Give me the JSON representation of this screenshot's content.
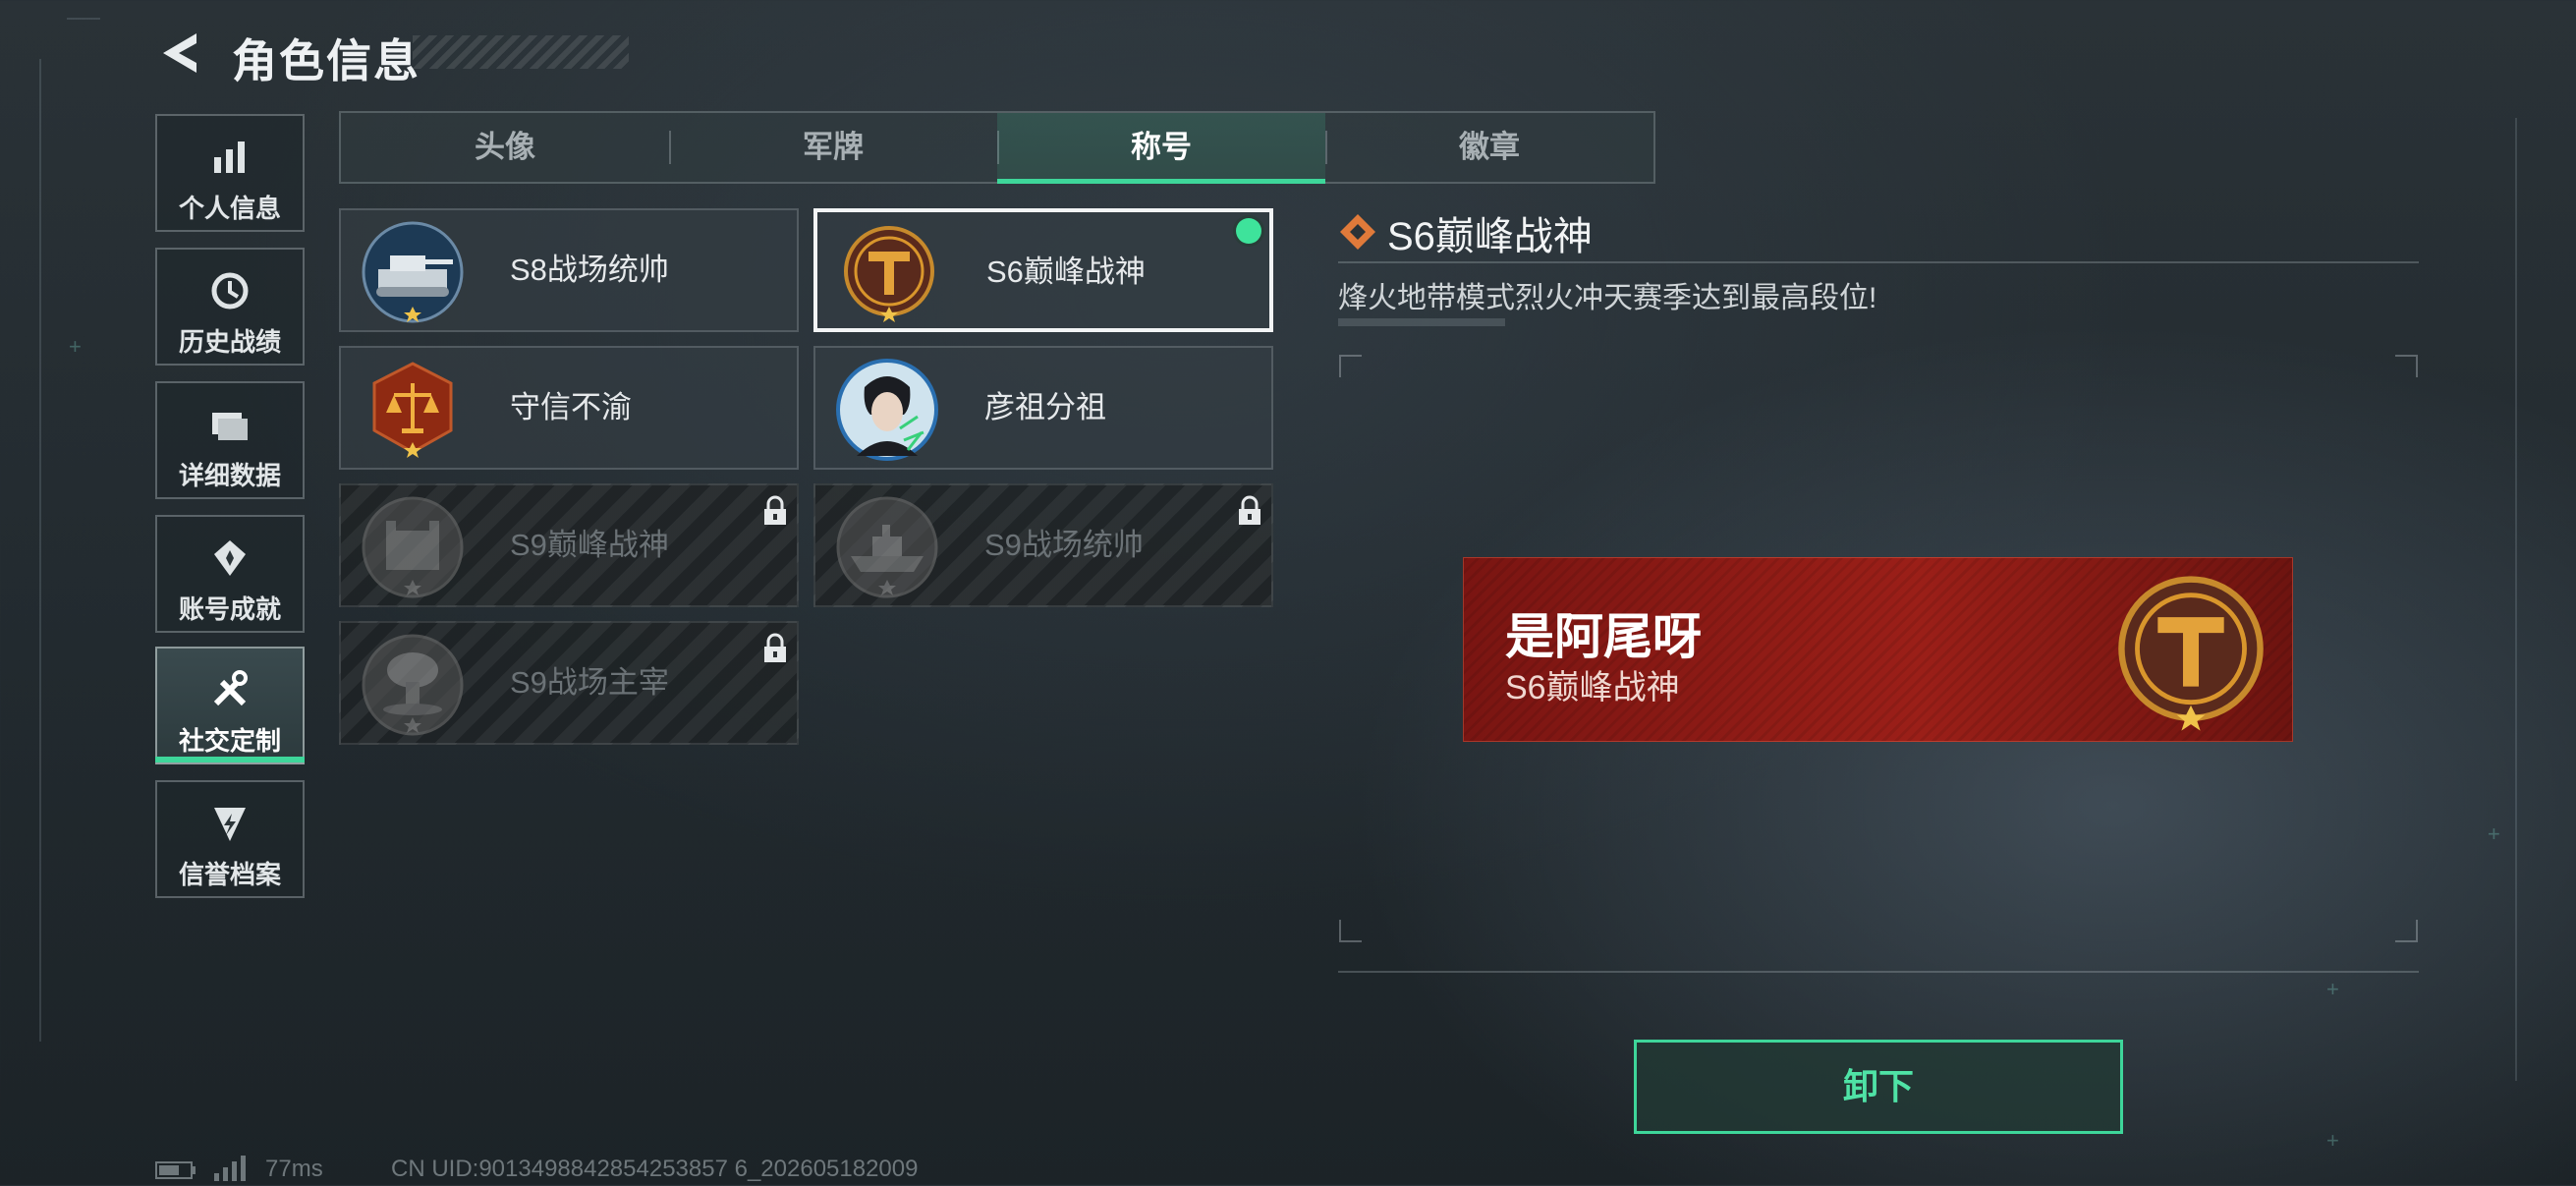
{
  "header": {
    "title": "角色信息"
  },
  "sidebar": {
    "items": [
      {
        "label": "个人信息",
        "icon": "bar-chart-icon"
      },
      {
        "label": "历史战绩",
        "icon": "history-icon"
      },
      {
        "label": "详细数据",
        "icon": "folder-icon"
      },
      {
        "label": "账号成就",
        "icon": "achievement-icon"
      },
      {
        "label": "社交定制",
        "icon": "tools-icon",
        "active": true
      },
      {
        "label": "信誉档案",
        "icon": "reputation-icon"
      }
    ]
  },
  "tabs": [
    {
      "label": "头像"
    },
    {
      "label": "军牌"
    },
    {
      "label": "称号",
      "active": true
    },
    {
      "label": "徽章"
    }
  ],
  "titles": [
    {
      "name": "S8战场统帅",
      "locked": false,
      "selected": false,
      "equipped": false,
      "icon": "tank-medal-icon"
    },
    {
      "name": "S6巅峰战神",
      "locked": false,
      "selected": true,
      "equipped": true,
      "icon": "gold-t-medal-icon"
    },
    {
      "name": "守信不渝",
      "locked": false,
      "selected": false,
      "equipped": false,
      "icon": "scales-medal-icon"
    },
    {
      "name": "彦祖分祖",
      "locked": false,
      "selected": false,
      "equipped": false,
      "icon": "portrait-medal-icon"
    },
    {
      "name": "S9巅峰战神",
      "locked": true,
      "selected": false,
      "equipped": false,
      "icon": "fortress-medal-icon"
    },
    {
      "name": "S9战场统帅",
      "locked": true,
      "selected": false,
      "equipped": false,
      "icon": "warship-medal-icon"
    },
    {
      "name": "S9战场主宰",
      "locked": true,
      "selected": false,
      "equipped": false,
      "icon": "explosion-medal-icon"
    }
  ],
  "detail": {
    "title": "S6巅峰战神",
    "description": "烽火地带模式烈火冲天赛季达到最高段位!",
    "preview": {
      "player_name": "是阿尾呀",
      "title": "S6巅峰战神"
    },
    "action_label": "卸下"
  },
  "footer": {
    "ping": "77ms",
    "uid": "CN UID:9013498842854253857 6_202605182009"
  },
  "colors": {
    "accent": "#3ed69a",
    "banner": "#8f1c16",
    "gold": "#d9962c"
  }
}
